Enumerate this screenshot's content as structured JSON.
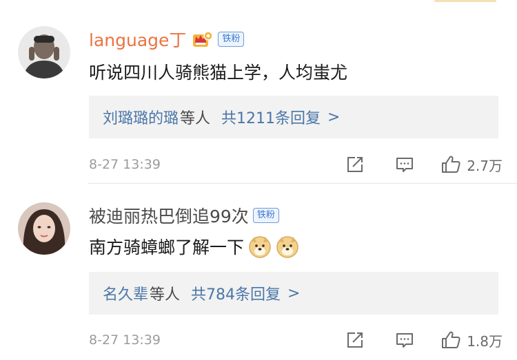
{
  "comments": [
    {
      "username": "language丁",
      "badge": "铁粉",
      "text": "听说四川人骑熊猫上学，人均蚩尤",
      "reply_names": "刘璐璐的璐",
      "reply_mid": "等人",
      "reply_count": "共1211条回复",
      "reply_arrow": ">",
      "time": "8-27 13:39",
      "likes": "2.7万"
    },
    {
      "username": "被迪丽热巴倒追99次",
      "badge": "铁粉",
      "text": "南方骑蟑螂了解一下",
      "reply_names": "名久辈",
      "reply_mid": "等人",
      "reply_count": "共784条回复",
      "reply_arrow": ">",
      "time": "8-27 13:39",
      "likes": "1.8万"
    }
  ],
  "colors": {
    "username_vip": "#eb7340",
    "link_blue": "#4a76a8",
    "reply_bg": "#f2f2f2",
    "meta_gray": "#9b9b9b"
  }
}
